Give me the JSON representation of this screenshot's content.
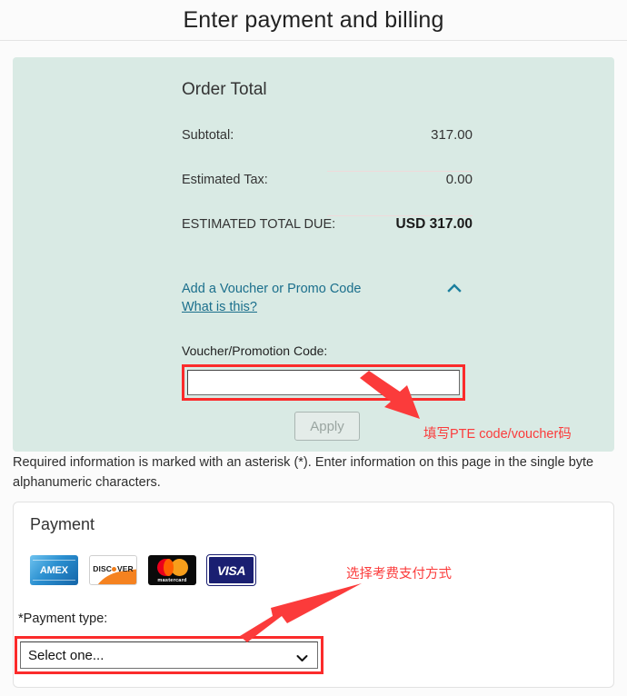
{
  "header": {
    "title": "Enter payment and billing"
  },
  "order": {
    "heading": "Order Total",
    "rows": [
      {
        "label": "Subtotal:",
        "value": "317.00"
      },
      {
        "label": "Estimated Tax:",
        "value": "0.00"
      }
    ],
    "grand": {
      "label": "ESTIMATED TOTAL DUE:",
      "value": "USD 317.00"
    },
    "voucher_toggle_label": "Add a Voucher or Promo Code",
    "what_is_this_label": "What is this?",
    "collapse_icon": "chevron-up-icon",
    "code_field_label": "Voucher/Promotion Code:",
    "code_value": "",
    "code_placeholder": "",
    "apply_label": "Apply",
    "panel_color": "#d9eae4",
    "link_color": "#1b6f8c"
  },
  "required_note": "Required information is marked with an asterisk (*). Enter information on this page in the single byte alphanumeric characters.",
  "payment": {
    "heading": "Payment",
    "cards": [
      {
        "name": "amex-card-logo",
        "label": "AMEX"
      },
      {
        "name": "discover-card-logo",
        "label": "DISC",
        "label2": "VER"
      },
      {
        "name": "mastercard-card-logo",
        "label": "mastercard"
      },
      {
        "name": "visa-card-logo",
        "label": "VISA"
      }
    ],
    "type_label": "*Payment type:",
    "type_selected": "Select one...",
    "type_options": [
      "Select one..."
    ],
    "caret_icon": "chevron-down-icon"
  },
  "annotations": [
    {
      "name": "voucher-annotation",
      "text": "填写PTE code/voucher码",
      "color": "#fb3b3b"
    },
    {
      "name": "payment-type-annotation",
      "text": "选择考费支付方式",
      "color": "#fb3b3b"
    }
  ],
  "highlight_color": "#fb2b2b"
}
